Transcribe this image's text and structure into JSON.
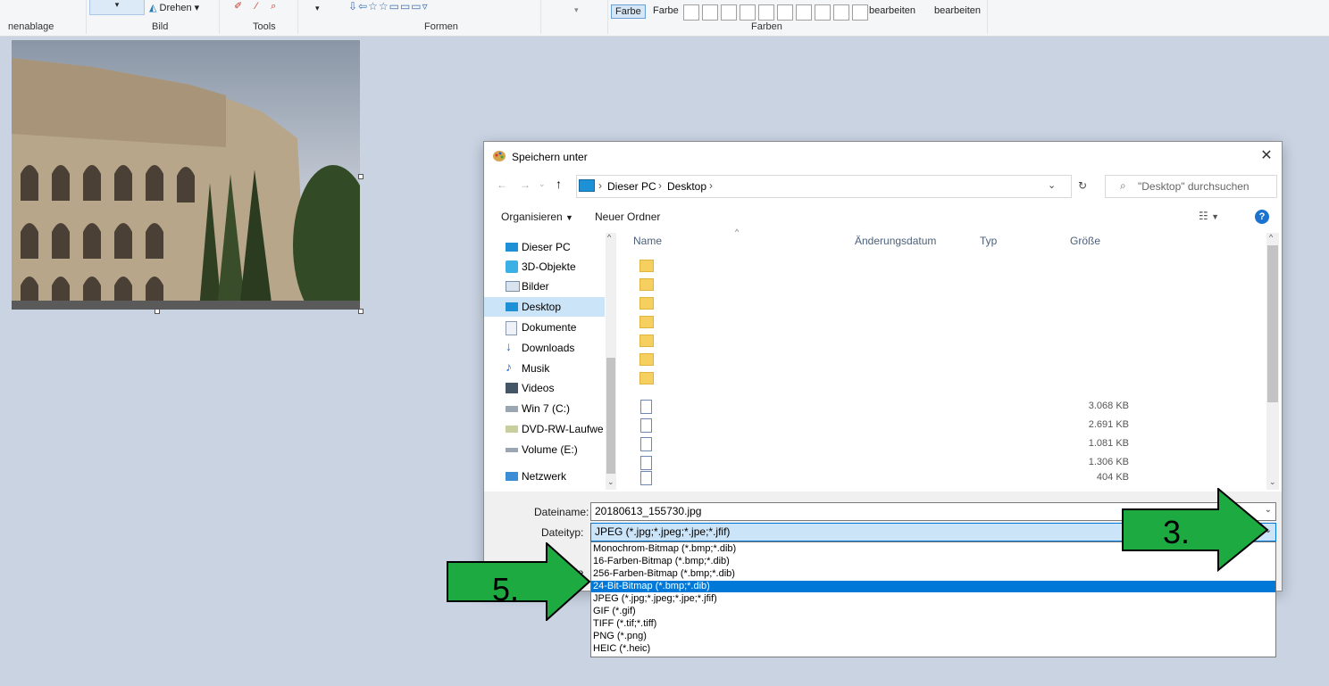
{
  "ribbon": {
    "groups": [
      "nenablage",
      "Bild",
      "Tools",
      "Formen",
      "Farben"
    ],
    "rotate_label": "Drehen",
    "color1_label": "Farbe",
    "color2_label": "Farbe",
    "edit1_label": "bearbeiten",
    "edit2_label": "bearbeiten"
  },
  "dialog": {
    "title": "Speichern unter",
    "breadcrumb": [
      "Dieser PC",
      "Desktop"
    ],
    "search_placeholder": "\"Desktop\" durchsuchen",
    "organize_label": "Organisieren",
    "new_folder_label": "Neuer Ordner",
    "help_label": "?",
    "nav_items": [
      "Dieser PC",
      "3D-Objekte",
      "Bilder",
      "Desktop",
      "Dokumente",
      "Downloads",
      "Musik",
      "Videos",
      "Win 7 (C:)",
      "DVD-RW-Laufwerk",
      "Volume (E:)",
      "Netzwerk"
    ],
    "selected_nav": "Desktop",
    "columns": [
      "Name",
      "Änderungsdatum",
      "Typ",
      "Größe"
    ],
    "file_sizes": [
      "3.068 KB",
      "2.691 KB",
      "1.081 KB",
      "1.306 KB",
      "404 KB"
    ],
    "filename_label": "Dateiname:",
    "filename_value": "20180613_155730.jpg",
    "filetype_label": "Dateityp:",
    "filetype_value": "JPEG (*.jpg;*.jpeg;*.jpe;*.jfif)",
    "hidden_label_fragment": "de"
  },
  "dropdown_options": [
    "Monochrom-Bitmap (*.bmp;*.dib)",
    "16-Farben-Bitmap (*.bmp;*.dib)",
    "256-Farben-Bitmap (*.bmp;*.dib)",
    "24-Bit-Bitmap (*.bmp;*.dib)",
    "JPEG (*.jpg;*.jpeg;*.jpe;*.jfif)",
    "GIF (*.gif)",
    "TIFF (*.tif;*.tiff)",
    "PNG (*.png)",
    "HEIC (*.heic)"
  ],
  "selected_option_index": 3,
  "annotations": {
    "arrow_3": "3.",
    "arrow_5": "5."
  },
  "colors": {
    "accent": "#0078d7",
    "arrow": "#1daa41",
    "selection": "#cce4f7"
  }
}
